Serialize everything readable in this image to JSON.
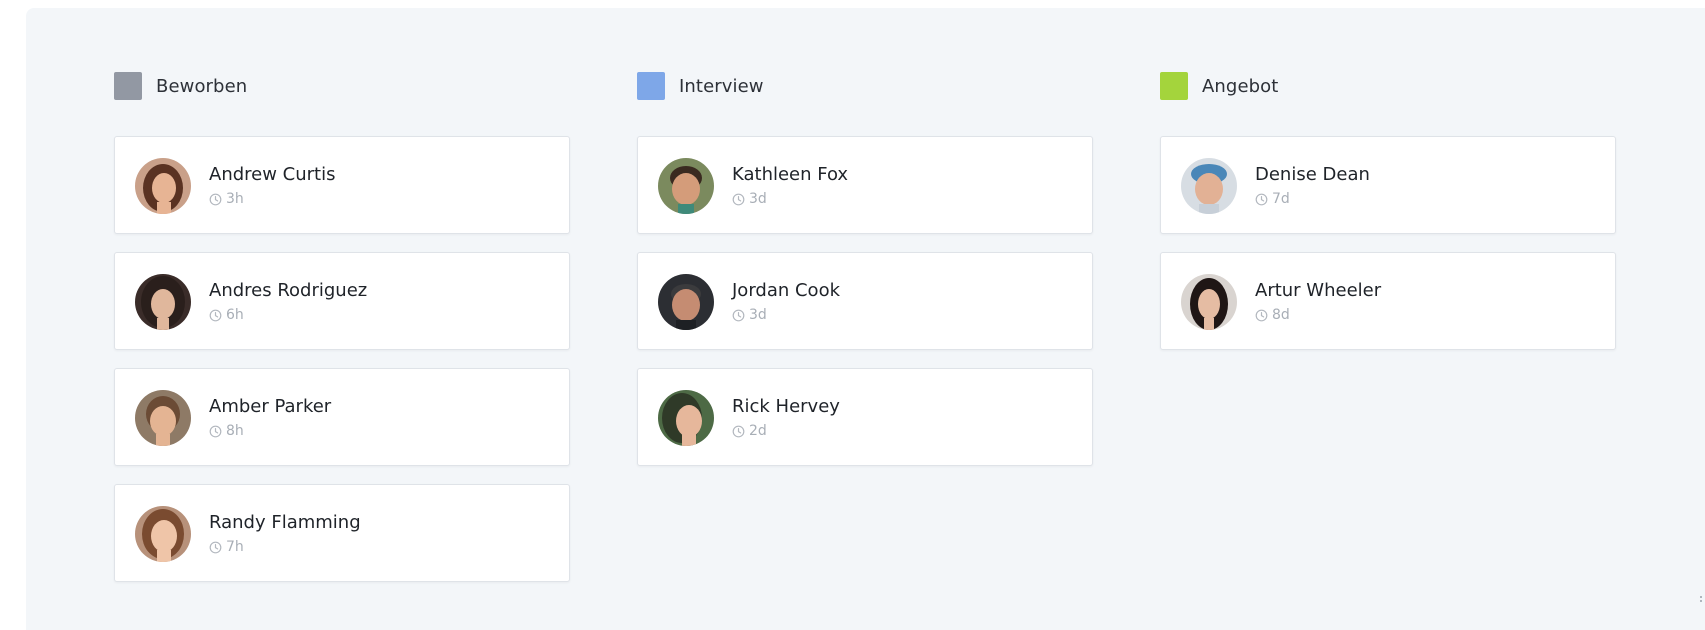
{
  "board": {
    "columns": [
      {
        "title": "Beworben",
        "color": "#9298a3",
        "cards": [
          {
            "name": "Andrew Curtis",
            "time": "3h",
            "avatar_icon": "avatar-woman-brown-hair",
            "hair": "#5a3222",
            "skin": "#e7b494"
          },
          {
            "name": "Andres Rodriguez",
            "time": "6h",
            "avatar_icon": "avatar-woman-dark-hair",
            "hair": "#2a1f1c",
            "skin": "#e0b79c"
          },
          {
            "name": "Amber Parker",
            "time": "8h",
            "avatar_icon": "avatar-woman-tied-hair",
            "hair": "#6b4b35",
            "skin": "#e4b493"
          },
          {
            "name": "Randy Flamming",
            "time": "7h",
            "avatar_icon": "avatar-woman-light-brown-hair",
            "hair": "#7a4b30",
            "skin": "#efc5a8"
          }
        ]
      },
      {
        "title": "Interview",
        "color": "#7ea7e8",
        "cards": [
          {
            "name": "Kathleen Fox",
            "time": "3d",
            "avatar_icon": "avatar-child",
            "hair": "#3a2a20",
            "skin": "#d49c7a"
          },
          {
            "name": "Jordan Cook",
            "time": "3d",
            "avatar_icon": "avatar-man-short-hair",
            "hair": "#3b3b3d",
            "skin": "#c58c72"
          },
          {
            "name": "Rick Hervey",
            "time": "2d",
            "avatar_icon": "avatar-woman-smiling",
            "hair": "#2f3a28",
            "skin": "#e6b79b"
          }
        ]
      },
      {
        "title": "Angebot",
        "color": "#a4d43c",
        "cards": [
          {
            "name": "Denise Dean",
            "time": "7d",
            "avatar_icon": "avatar-man-blue-cap",
            "hair": "#4a87b8",
            "skin": "#e2b195"
          },
          {
            "name": "Artur Wheeler",
            "time": "8d",
            "avatar_icon": "avatar-woman-long-dark-hair",
            "hair": "#1f1615",
            "skin": "#e5bca3"
          }
        ]
      }
    ]
  }
}
